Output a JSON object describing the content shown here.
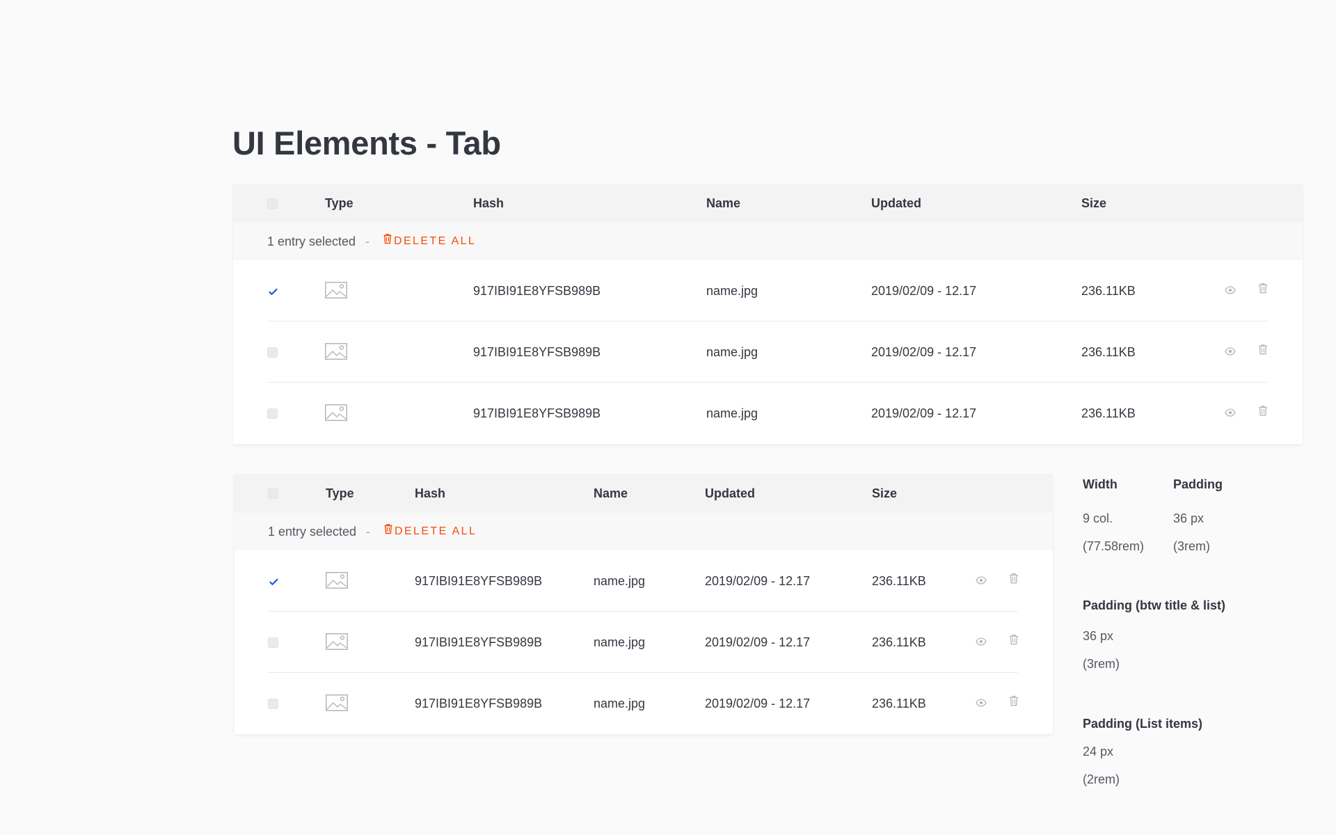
{
  "page": {
    "title": "UI Elements - Tab"
  },
  "table1": {
    "headers": {
      "type": "Type",
      "hash": "Hash",
      "name": "Name",
      "updated": "Updated",
      "size": "Size"
    },
    "selection": {
      "text": "1 entry selected",
      "separator": "-",
      "delete_all": "DELETE ALL"
    },
    "rows": [
      {
        "checked": true,
        "hash": "917IBI91E8YFSB989B",
        "name": "name.jpg",
        "updated": "2019/02/09 - 12.17",
        "size": "236.11KB"
      },
      {
        "checked": false,
        "hash": "917IBI91E8YFSB989B",
        "name": "name.jpg",
        "updated": "2019/02/09 - 12.17",
        "size": "236.11KB"
      },
      {
        "checked": false,
        "hash": "917IBI91E8YFSB989B",
        "name": "name.jpg",
        "updated": "2019/02/09 - 12.17",
        "size": "236.11KB"
      }
    ]
  },
  "table2": {
    "headers": {
      "type": "Type",
      "hash": "Hash",
      "name": "Name",
      "updated": "Updated",
      "size": "Size"
    },
    "selection": {
      "text": "1 entry selected",
      "separator": "-",
      "delete_all": "DELETE ALL"
    },
    "rows": [
      {
        "checked": true,
        "hash": "917IBI91E8YFSB989B",
        "name": "name.jpg",
        "updated": "2019/02/09 - 12.17",
        "size": "236.11KB"
      },
      {
        "checked": false,
        "hash": "917IBI91E8YFSB989B",
        "name": "name.jpg",
        "updated": "2019/02/09 - 12.17",
        "size": "236.11KB"
      },
      {
        "checked": false,
        "hash": "917IBI91E8YFSB989B",
        "name": "name.jpg",
        "updated": "2019/02/09 - 12.17",
        "size": "236.11KB"
      }
    ]
  },
  "specs": {
    "width": {
      "label": "Width",
      "value": "9 col.",
      "value_rem": "(77.58rem)"
    },
    "padding": {
      "label": "Padding",
      "value": "36 px",
      "value_rem": "(3rem)"
    },
    "padding_title_list": {
      "label": "Padding (btw title & list)",
      "value": "36 px",
      "value_rem": "(3rem)"
    },
    "padding_list_items": {
      "label": "Padding (List items)",
      "value": "24 px",
      "value_rem": "(2rem)"
    }
  },
  "colors": {
    "accent_blue": "#1c5de7",
    "delete_red": "#f64d0a",
    "icon_gray": "#b3b5b9",
    "background": "#fafafa"
  },
  "icons": {
    "checkbox_checked": "check-icon",
    "type": "image-icon",
    "view": "eye-icon",
    "delete": "trash-icon"
  }
}
